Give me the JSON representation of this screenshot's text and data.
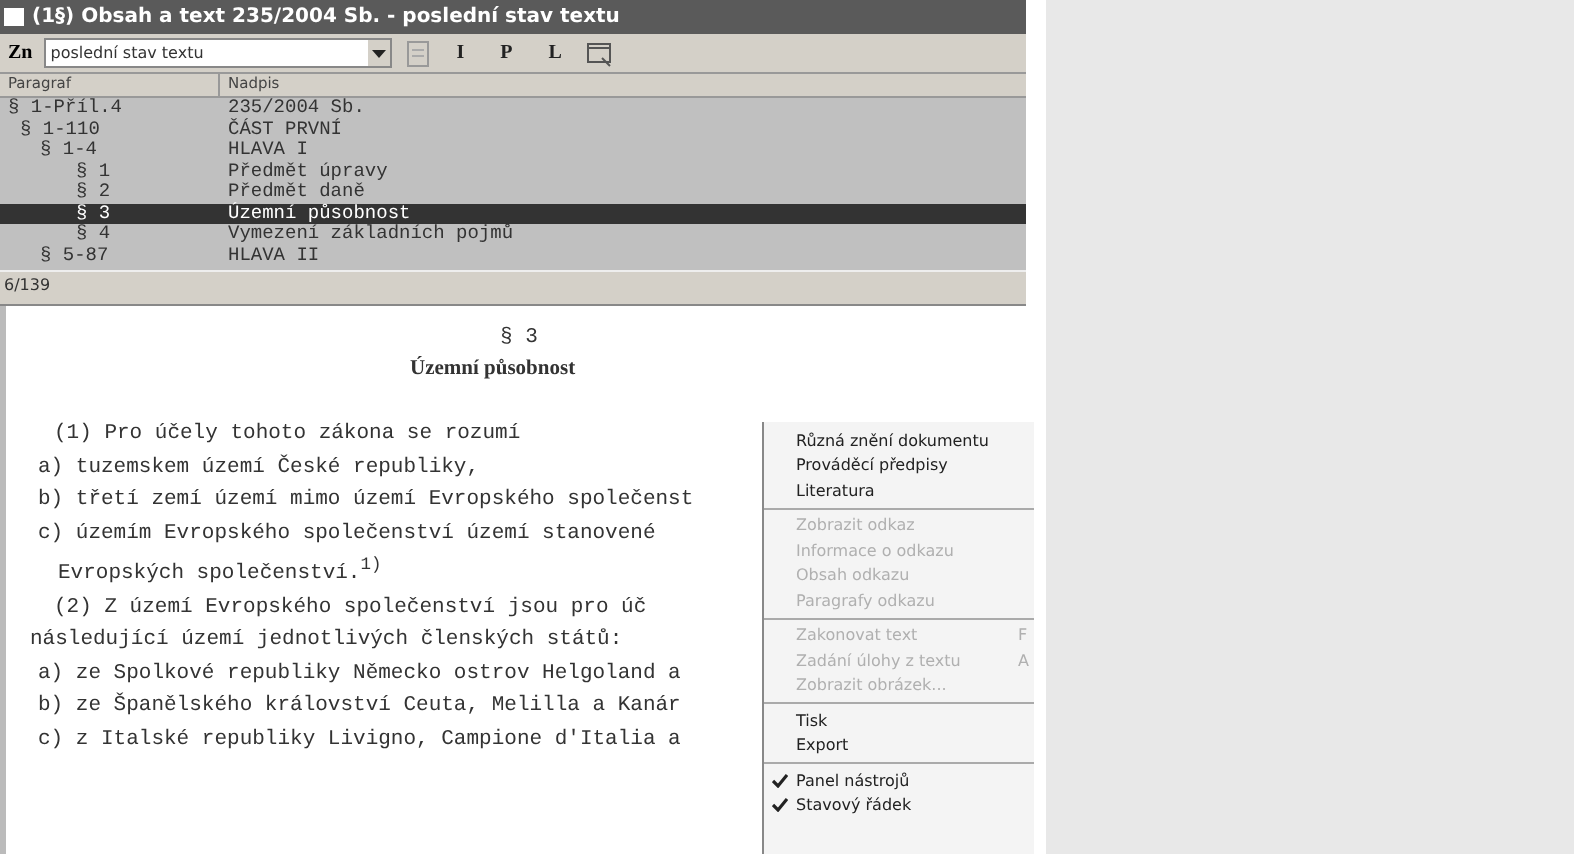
{
  "window": {
    "title": "(1§) Obsah a text 235/2004 Sb. - poslední stav textu"
  },
  "toolbar": {
    "zn_label": "Zn",
    "version_select": "poslední stav textu",
    "buttons": [
      "I",
      "P",
      "L"
    ]
  },
  "tree": {
    "columns": [
      "Paragraf",
      "Nadpis"
    ],
    "rows": [
      {
        "paragraph": "§ 1-Příl.4",
        "title": "235/2004 Sb.",
        "selected": false,
        "children": [
          {
            "paragraph": "§ 1-110",
            "title": "ČÁST PRVNÍ",
            "selected": false,
            "children": [
              {
                "paragraph": "§ 1-4",
                "title": "HLAVA I",
                "selected": false,
                "children": [
                  {
                    "paragraph": "§ 1",
                    "title": "Předmět úpravy",
                    "selected": false
                  },
                  {
                    "paragraph": "§ 2",
                    "title": "Předmět daně",
                    "selected": false
                  },
                  {
                    "paragraph": "§ 3",
                    "title": "Územní působnost",
                    "selected": true
                  },
                  {
                    "paragraph": "§ 4",
                    "title": "Vymezení základních pojmů",
                    "selected": false
                  }
                ]
              },
              {
                "paragraph": "§ 5-87",
                "title": "HLAVA II",
                "selected": false
              }
            ]
          }
        ]
      }
    ]
  },
  "status_bar": "6/139",
  "document": {
    "heading": "§ 3",
    "title": "Územní působnost",
    "paragraphs": [
      {
        "kind": "para",
        "text": "(1) Pro účely tohoto zákona se rozumí"
      },
      {
        "kind": "item",
        "text": "a) tuzemskem území České republiky,"
      },
      {
        "kind": "item",
        "text": "b) třetí zemí území mimo území Evropského společenst"
      },
      {
        "kind": "item",
        "text": "c) územím Evropského společenství území stanovené"
      },
      {
        "kind": "cont",
        "text": "Evropských společenství.$^{1)}$"
      },
      {
        "kind": "para",
        "text": "(2) Z území Evropského společenství jsou pro úč"
      },
      {
        "kind": "flush",
        "text": "následující území jednotlivých členských států:"
      },
      {
        "kind": "item",
        "text": "a) ze Spolkové republiky Německo ostrov Helgoland a"
      },
      {
        "kind": "item",
        "text": "b) ze Španělského království Ceuta, Melilla a Kanár"
      },
      {
        "kind": "item",
        "text": "c) z Italské republiky Livigno, Campione d'Italia a"
      }
    ]
  },
  "context_menu": [
    {
      "kind": "item",
      "label": "Různá znění dokumentu",
      "disabled": false
    },
    {
      "kind": "item",
      "label": "Prováděcí předpisy",
      "disabled": false
    },
    {
      "kind": "item",
      "label": "Literatura",
      "disabled": false
    },
    {
      "kind": "separator"
    },
    {
      "kind": "item",
      "label": "Zobrazit odkaz",
      "disabled": true
    },
    {
      "kind": "item",
      "label": "Informace o odkazu",
      "disabled": true
    },
    {
      "kind": "item",
      "label": "Obsah odkazu",
      "disabled": true
    },
    {
      "kind": "item",
      "label": "Paragrafy odkazu",
      "disabled": true
    },
    {
      "kind": "separator"
    },
    {
      "kind": "item",
      "label": "Zakonovat text",
      "shortcut": "F",
      "disabled": true
    },
    {
      "kind": "item",
      "label": "Zadání úlohy z textu",
      "shortcut": "A",
      "disabled": true
    },
    {
      "kind": "item",
      "label": "Zobrazit obrázek...",
      "disabled": true
    },
    {
      "kind": "separator"
    },
    {
      "kind": "item",
      "label": "Tisk",
      "disabled": false
    },
    {
      "kind": "item",
      "label": "Export",
      "disabled": false
    },
    {
      "kind": "separator"
    },
    {
      "kind": "check",
      "label": "Panel nástrojů",
      "checked": true,
      "disabled": false
    },
    {
      "kind": "check",
      "label": "Stavový řádek",
      "checked": true,
      "disabled": false
    }
  ]
}
